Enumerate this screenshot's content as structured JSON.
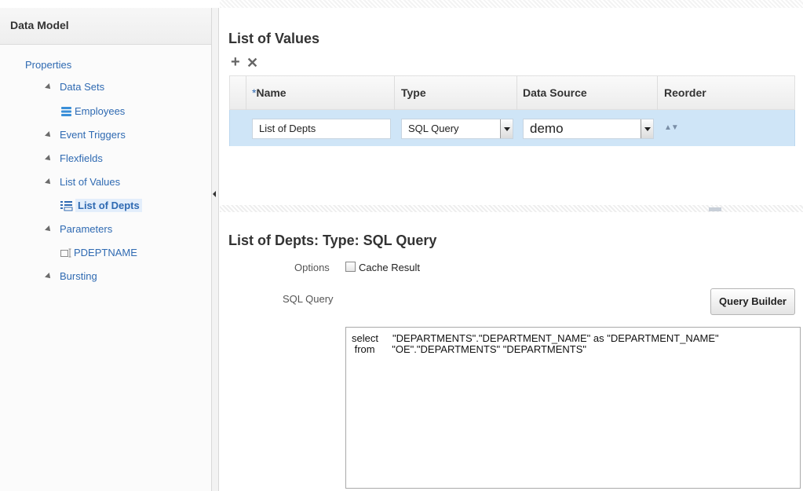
{
  "left_panel": {
    "title": "Data Model",
    "properties": "Properties",
    "data_sets": "Data Sets",
    "employees": "Employees",
    "event_triggers": "Event Triggers",
    "flexfields": "Flexfields",
    "list_of_values": "List of Values",
    "list_of_depts": "List of Depts",
    "parameters": "Parameters",
    "pdeptname": "PDEPTNAME",
    "bursting": "Bursting"
  },
  "lov": {
    "title": "List of Values",
    "add_icon": "+",
    "delete_icon": "✕",
    "columns": {
      "name_required": "*",
      "name": "Name",
      "type": "Type",
      "data_source": "Data Source",
      "reorder": "Reorder"
    },
    "row": {
      "name": "List of Depts",
      "type": "SQL Query",
      "data_source": "demo",
      "reorder": "▲▼"
    }
  },
  "detail": {
    "title": "List of Depts: Type: SQL Query",
    "options_label": "Options",
    "cache_result_label": "Cache Result",
    "cache_result_checked": false,
    "sql_query_label": "SQL Query",
    "query_builder_label": "Query Builder",
    "sql_text": "select     \"DEPARTMENTS\".\"DEPARTMENT_NAME\" as \"DEPARTMENT_NAME\"\n from      \"OE\".\"DEPARTMENTS\" \"DEPARTMENTS\""
  },
  "colors": {
    "link": "#2f6ab2",
    "selected_row": "#cfe5f7"
  }
}
